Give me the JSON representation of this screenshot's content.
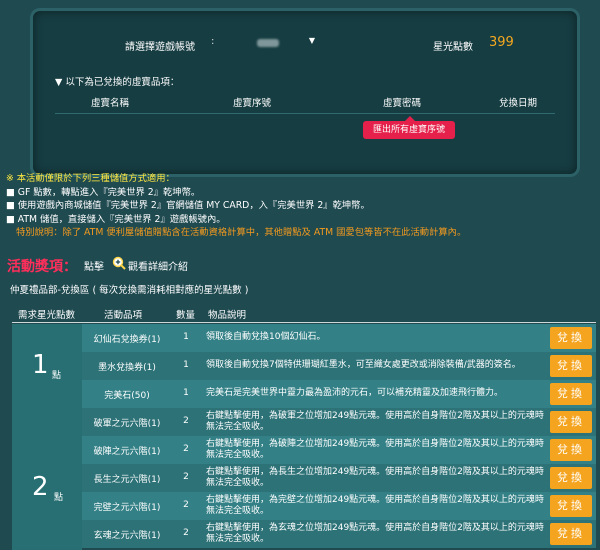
{
  "account": {
    "label": "請選擇遊戲帳號",
    "colon": ":",
    "star_label": "星光點數",
    "star_value": "399"
  },
  "redeemed": {
    "title": "▼ 以下為已兌換的虛寶品項：",
    "columns": [
      "虛寶名稱",
      "虛寶序號",
      "虛寶密碼",
      "兌換日期"
    ],
    "export_label": "匯出所有虛寶序號"
  },
  "notice": {
    "title": "※ 本活動僅限於下列三種儲值方式適用：",
    "lines": [
      "■ GF 點數，轉點進入『完美世界 2』乾坤幣。",
      "■ 使用遊戲內商城儲值『完美世界 2』官網儲值 MY CARD，入『完美世界 2』乾坤幣。",
      "■ ATM 儲值，直接儲入『完美世界 2』遊戲帳號內。"
    ],
    "special": "特別說明：除了 ATM 便利屋儲值贈點含在活動資格計算中，其他贈點及 ATM 國愛包等皆不在此活動計算內。"
  },
  "activity": {
    "title": "活動獎項：",
    "hint": "點擊",
    "link": "觀看詳細介紹",
    "zone_title": "仲夏禮品部-兌換區 ( 每次兌換需消耗相對應的星光點數 )"
  },
  "table": {
    "headers": [
      "需求星光點數",
      "活動品項",
      "數量",
      "物品說明"
    ],
    "groups": [
      {
        "points": "1",
        "unit": "點",
        "rows": [
          {
            "name": "幻仙石兌換券(1)",
            "qty": "1",
            "desc": "領取後自動兌換10個幻仙石。"
          },
          {
            "name": "墨水兌換券(1)",
            "qty": "1",
            "desc": "領取後自動兌換7個特供珊瑚紅墨水，可至織女處更改或消除裝備/武器的簽名。"
          },
          {
            "name": "完美石(50)",
            "qty": "1",
            "desc": "完美石是完美世界中靈力最為盈沛的元石，可以補充精靈及加速飛行體力。"
          }
        ]
      },
      {
        "points": "2",
        "unit": "點",
        "rows": [
          {
            "name": "破軍之元六階(1)",
            "qty": "2",
            "desc": "右鍵點擊使用，為破軍之位增加249點元魂。使用高於自身階位2階及其以上的元魂時無法完全吸收。"
          },
          {
            "name": "破陣之元六階(1)",
            "qty": "2",
            "desc": "右鍵點擊使用，為破陣之位增加249點元魂。使用高於自身階位2階及其以上的元魂時無法完全吸收。"
          },
          {
            "name": "長生之元六階(1)",
            "qty": "2",
            "desc": "右鍵點擊使用，為長生之位增加249點元魂。使用高於自身階位2階及其以上的元魂時無法完全吸收。"
          },
          {
            "name": "完壁之元六階(1)",
            "qty": "2",
            "desc": "右鍵點擊使用，為完壁之位增加249點元魂。使用高於自身階位2階及其以上的元魂時無法完全吸收。"
          },
          {
            "name": "玄魂之元六階(1)",
            "qty": "2",
            "desc": "右鍵點擊使用，為玄魂之位增加249點元魂。使用高於自身階位2階及其以上的元魂時無法完全吸收。"
          }
        ]
      }
    ],
    "button_label": "兌換"
  },
  "icons": {
    "caret": "caret-down-icon",
    "magnifier": "magnifier-plus-icon"
  }
}
